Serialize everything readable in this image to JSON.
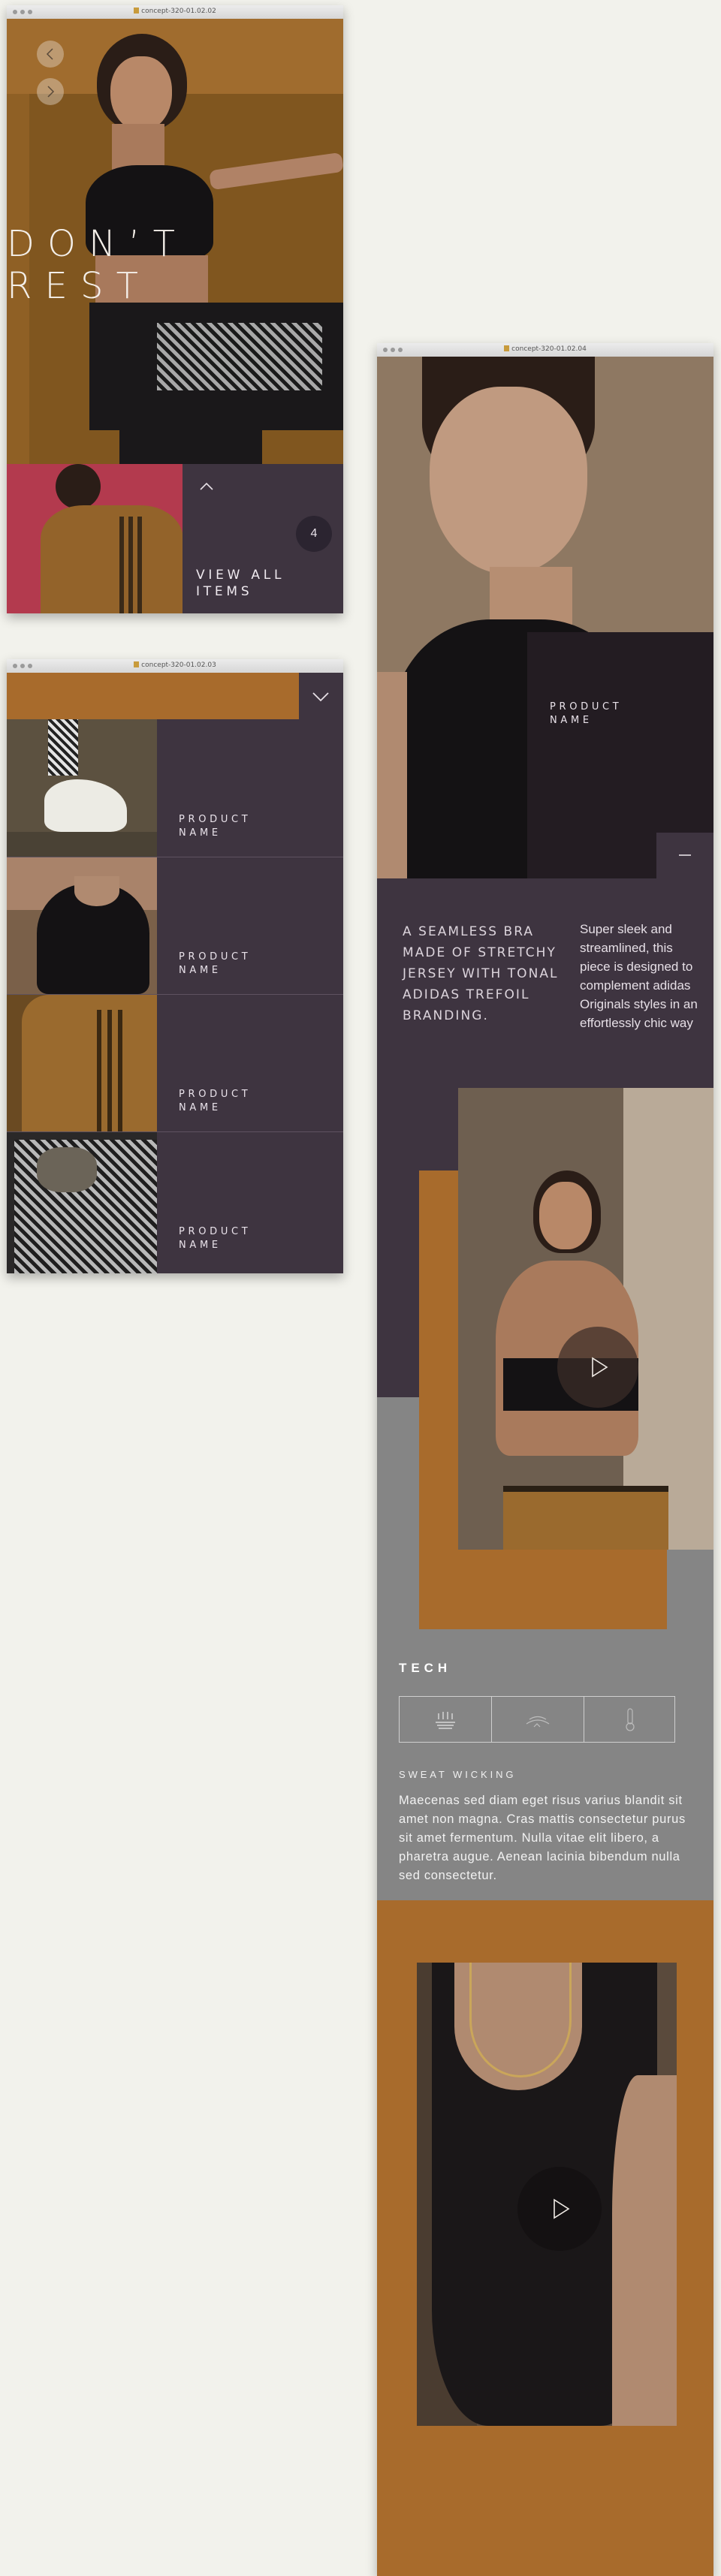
{
  "windows": {
    "w1_title": "concept-320-01.02.02",
    "w2_title": "concept-320-01.02.03",
    "w3_title": "concept-320-01.02.04"
  },
  "hero": {
    "headline_line1": "D O N ’ T",
    "headline_line2": "R E S T",
    "count": "4",
    "view_all": "VIEW ALL ITEMS"
  },
  "products": [
    {
      "name": "PRODUCT NAME"
    },
    {
      "name": "PRODUCT NAME"
    },
    {
      "name": "PRODUCT NAME"
    },
    {
      "name": "PRODUCT NAME"
    }
  ],
  "detail": {
    "product_name": "PRODUCT NAME",
    "headline": "A SEAMLESS BRA MADE OF STRETCHY JERSEY WITH TONAL ADIDAS TREFOIL BRANDING.",
    "description": "Super sleek and streamlined, this piece is designed to complement adidas Originals styles in an effortlessly chic way",
    "tech_title": "TECH",
    "feature_title": "SWEAT WICKING",
    "feature_body": "Maecenas sed diam eget risus varius blandit sit amet non magna. Cras mattis consectetur purus sit amet fermentum. Nulla vitae elit libero, a pharetra augue. Aenean lacinia bibendum nulla sed consectetur.",
    "tech_icons": [
      "sweat-wicking-icon",
      "breathable-icon",
      "temperature-icon"
    ]
  },
  "colors": {
    "brand_mustard": "#a86b2c",
    "panel_plum": "#3e3440",
    "panel_dark": "#231c22",
    "tech_gray": "#858585",
    "page_bg": "#f2f2ec"
  }
}
